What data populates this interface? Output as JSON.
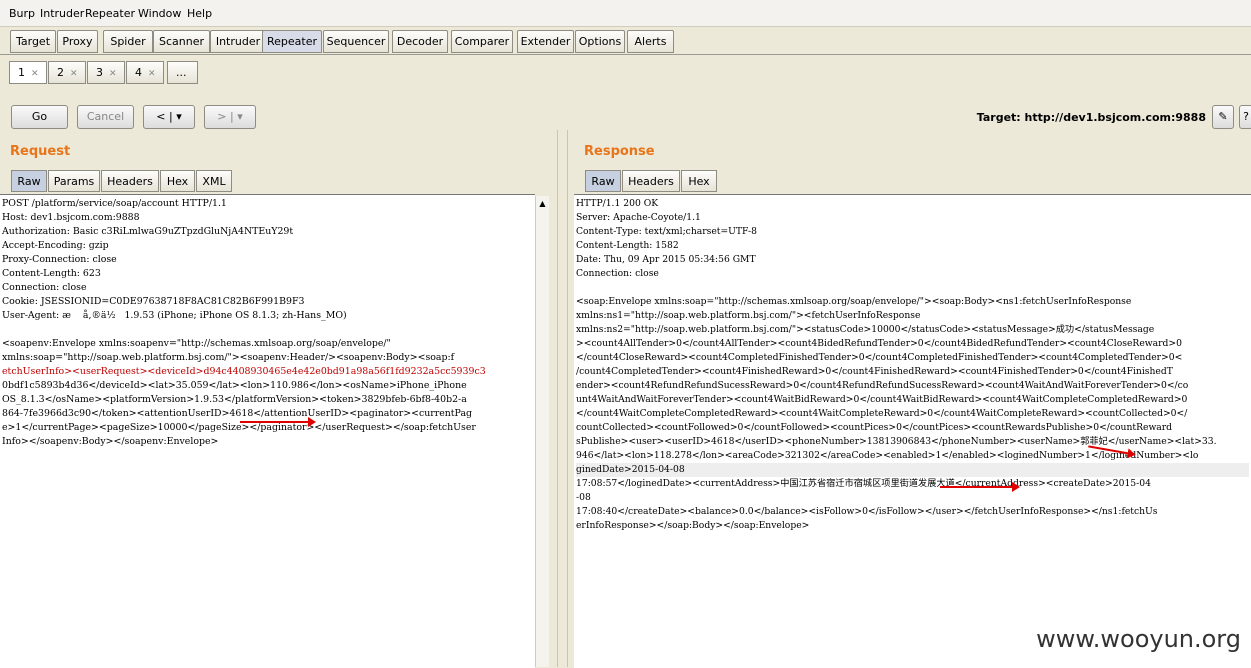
{
  "menu": [
    "Burp",
    "Intruder",
    "Repeater",
    "Window",
    "Help"
  ],
  "tabs": [
    "Target",
    "Proxy",
    "Spider",
    "Scanner",
    "Intruder",
    "Repeater",
    "Sequencer",
    "Decoder",
    "Comparer",
    "Extender",
    "Options",
    "Alerts"
  ],
  "selected_tab": "Repeater",
  "subtabs": [
    "1",
    "2",
    "3",
    "4",
    "..."
  ],
  "toolbar": {
    "go": "Go",
    "cancel": "Cancel",
    "back": "<",
    "fwd": ">",
    "dropdown": "▾",
    "target": "Target: http://dev1.bsjcom.com:9888"
  },
  "request": {
    "title": "Request",
    "tabs": [
      "Raw",
      "Params",
      "Headers",
      "Hex",
      "XML"
    ],
    "lines": [
      "POST /platform/service/soap/account HTTP/1.1",
      "Host: dev1.bsjcom.com:9888",
      "Authorization: Basic c3RiLmlwaG9uZTpzdGluNjA4NTEuY29t",
      "Accept-Encoding: gzip",
      "Proxy-Connection: close",
      "Content-Length: 623",
      "Connection: close",
      "Cookie: JSESSIONID=C0DE97638718F8AC81C82B6F991B9F3",
      "User-Agent: æ    å,®ä½   1.9.53 (iPhone; iPhone OS 8.1.3; zh-Hans_MO)",
      "",
      "<soapenv:Envelope xmlns:soapenv=\"http://schemas.xmlsoap.org/soap/envelope/\"",
      "xmlns:soap=\"http://soap.web.platform.bsj.com/\"><soapenv:Header/><soapenv:Body><soap:f",
      "etchUserInfo><userRequest><deviceId>d94c4408930465e4e42e0bd91a98a56f1fd9232a5cc5939c3",
      "0bdf1c5893b4d36</deviceId><lat>35.059</lat><lon>110.986</lon><osName>iPhone_iPhone",
      "OS_8.1.3</osName><platformVersion>1.9.53</platformVersion><token>3829bfeb-6bf8-40b2-a",
      "864-7fe3966d3c90</token><attentionUserID>4618</attentionUserID><paginator><currentPag",
      "e>1</currentPage><pageSize>10000</pageSize></paginator></userRequest></soap:fetchUser",
      "Info></soapenv:Body></soapenv:Envelope>"
    ]
  },
  "response": {
    "title": "Response",
    "tabs": [
      "Raw",
      "Headers",
      "Hex"
    ],
    "lines": [
      "HTTP/1.1 200 OK",
      "Server: Apache-Coyote/1.1",
      "Content-Type: text/xml;charset=UTF-8",
      "Content-Length: 1582",
      "Date: Thu, 09 Apr 2015 05:34:56 GMT",
      "Connection: close",
      "",
      "<soap:Envelope xmlns:soap=\"http://schemas.xmlsoap.org/soap/envelope/\"><soap:Body><ns1:fetchUserInfoResponse",
      "xmlns:ns1=\"http://soap.web.platform.bsj.com/\"><fetchUserInfoResponse",
      "xmlns:ns2=\"http://soap.web.platform.bsj.com/\"><statusCode>10000</statusCode><statusMessage>成功</statusMessage",
      "><count4AllTender>0</count4AllTender><count4BidedRefundTender>0</count4BidedRefundTender><count4CloseReward>0",
      "</count4CloseReward><count4CompletedFinishedTender>0</count4CompletedFinishedTender><count4CompletedTender>0<",
      "/count4CompletedTender><count4FinishedReward>0</count4FinishedReward><count4FinishedTender>0</count4FinishedT",
      "ender><count4RefundRefundSucessReward>0</count4RefundRefundSucessReward><count4WaitAndWaitForeverTender>0</co",
      "unt4WaitAndWaitForeverTender><count4WaitBidReward>0</count4WaitBidReward><count4WaitCompleteCompletedReward>0",
      "</count4WaitCompleteCompletedReward><count4WaitCompleteReward>0</count4WaitCompleteReward><countCollected>0</",
      "countCollected><countFollowed>0</countFollowed><countPices>0</countPices><countRewardsPublishe>0</countReward",
      "sPublishe><user><userID>4618</userID><phoneNumber>13813906843</phoneNumber><userName>郭菲妃</userName><lat>33.",
      "946</lat><lon>118.278</lon><areaCode>321302</areaCode><enabled>1</enabled><loginedNumber>1</loginedNumber><lo",
      "ginedDate>2015-04-08",
      "17:08:57</loginedDate><currentAddress>中国江苏省宿迁市宿城区项里街道发展大道</currentAddress><createDate>2015-04",
      "-08",
      "17:08:40</createDate><balance>0.0</balance><isFollow>0</isFollow></user></fetchUserInfoResponse></ns1:fetchUs",
      "erInfoResponse></soap:Body></soap:Envelope>"
    ]
  },
  "watermark": "www.wooyun.org"
}
